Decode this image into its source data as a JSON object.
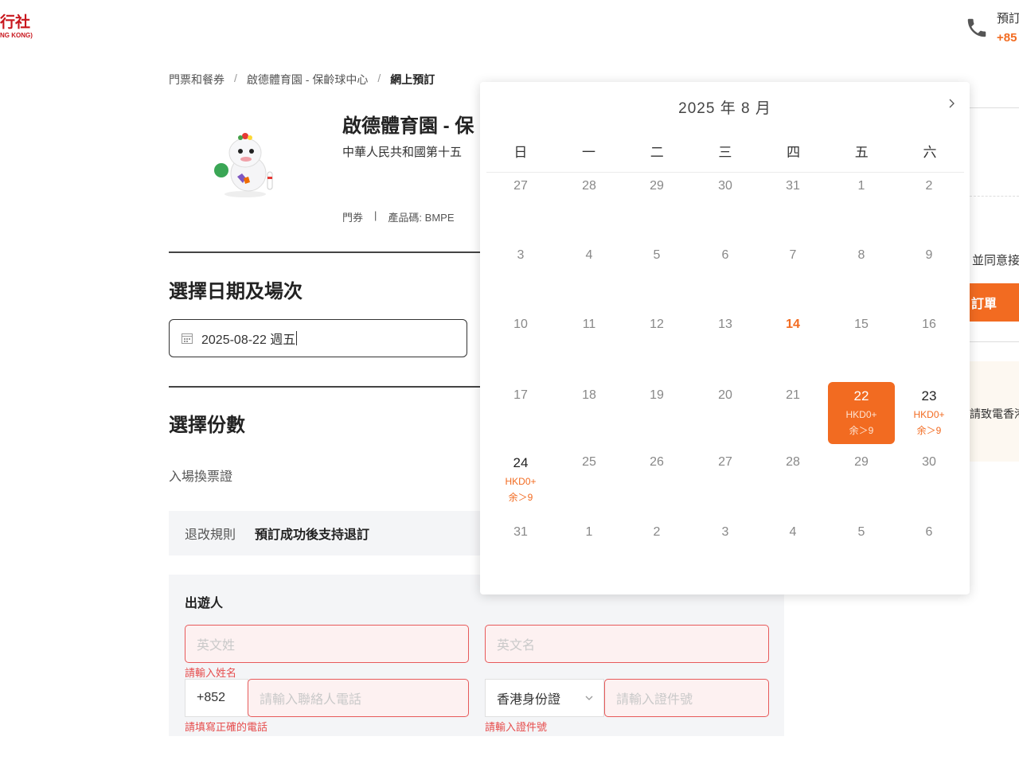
{
  "header": {
    "logo_zh": "行社",
    "logo_en": "NG KONG)",
    "title": "預訂",
    "phone": "+85"
  },
  "breadcrumb": [
    {
      "label": "門票和餐券"
    },
    {
      "label": "啟德體育園 - 保齡球中心"
    },
    {
      "label": "網上預訂"
    }
  ],
  "breadcrumb_sep": "/",
  "product": {
    "title": "啟德體育園 - 保",
    "subtitle": "中華人民共和國第十五",
    "type": "門券",
    "meta_sep": "|",
    "code_label": "產品碼:",
    "code": "BMPE"
  },
  "date_section": {
    "title": "選擇日期及場次",
    "value": "2025-08-22 週五"
  },
  "qty_section": {
    "title": "選擇份數",
    "ticket_label": "入場換票證"
  },
  "rules": {
    "label": "退改規則",
    "value": "預訂成功後支持退訂"
  },
  "traveler": {
    "title": "出遊人",
    "surname_placeholder": "英文姓",
    "surname_error": "請輸入姓名",
    "given_placeholder": "英文名",
    "country_code": "+852",
    "phone_placeholder": "請輸入聯絡人電話",
    "phone_error": "請填寫正確的電話",
    "id_type": "香港身份證",
    "id_placeholder": "請輸入證件號",
    "id_error": "請輸入證件號"
  },
  "sidebar": {
    "agree_text": "並同意接",
    "order_button": "訂單",
    "info_text": "請致電香港"
  },
  "calendar": {
    "title": "2025 年  8 月",
    "weekdays": [
      "日",
      "一",
      "二",
      "三",
      "四",
      "五",
      "六"
    ],
    "days": [
      {
        "n": "27",
        "s": "off"
      },
      {
        "n": "28",
        "s": "off"
      },
      {
        "n": "29",
        "s": "off"
      },
      {
        "n": "30",
        "s": "off"
      },
      {
        "n": "31",
        "s": "off"
      },
      {
        "n": "1",
        "s": "off"
      },
      {
        "n": "2",
        "s": "off"
      },
      {
        "n": "3",
        "s": "off"
      },
      {
        "n": "4",
        "s": "off"
      },
      {
        "n": "5",
        "s": "off"
      },
      {
        "n": "6",
        "s": "off"
      },
      {
        "n": "7",
        "s": "off"
      },
      {
        "n": "8",
        "s": "off"
      },
      {
        "n": "9",
        "s": "off"
      },
      {
        "n": "10",
        "s": "off"
      },
      {
        "n": "11",
        "s": "off"
      },
      {
        "n": "12",
        "s": "off"
      },
      {
        "n": "13",
        "s": "off"
      },
      {
        "n": "14",
        "s": "today"
      },
      {
        "n": "15",
        "s": "off"
      },
      {
        "n": "16",
        "s": "off"
      },
      {
        "n": "17",
        "s": "off"
      },
      {
        "n": "18",
        "s": "off"
      },
      {
        "n": "19",
        "s": "off"
      },
      {
        "n": "20",
        "s": "off"
      },
      {
        "n": "21",
        "s": "off"
      },
      {
        "n": "22",
        "s": "selected",
        "price": "HKD0+",
        "stock": "余＞9"
      },
      {
        "n": "23",
        "s": "avail",
        "price": "HKD0+",
        "stock": "余＞9"
      },
      {
        "n": "24",
        "s": "avail",
        "price": "HKD0+",
        "stock": "余＞9"
      },
      {
        "n": "25",
        "s": "off"
      },
      {
        "n": "26",
        "s": "off"
      },
      {
        "n": "27",
        "s": "off"
      },
      {
        "n": "28",
        "s": "off"
      },
      {
        "n": "29",
        "s": "off"
      },
      {
        "n": "30",
        "s": "off"
      },
      {
        "n": "31",
        "s": "off"
      },
      {
        "n": "1",
        "s": "off"
      },
      {
        "n": "2",
        "s": "off"
      },
      {
        "n": "3",
        "s": "off"
      },
      {
        "n": "4",
        "s": "off"
      },
      {
        "n": "5",
        "s": "off"
      },
      {
        "n": "6",
        "s": "off"
      }
    ]
  },
  "colors": {
    "accent": "#f26b21",
    "brand": "#c8161d",
    "error": "#e64d4d"
  }
}
